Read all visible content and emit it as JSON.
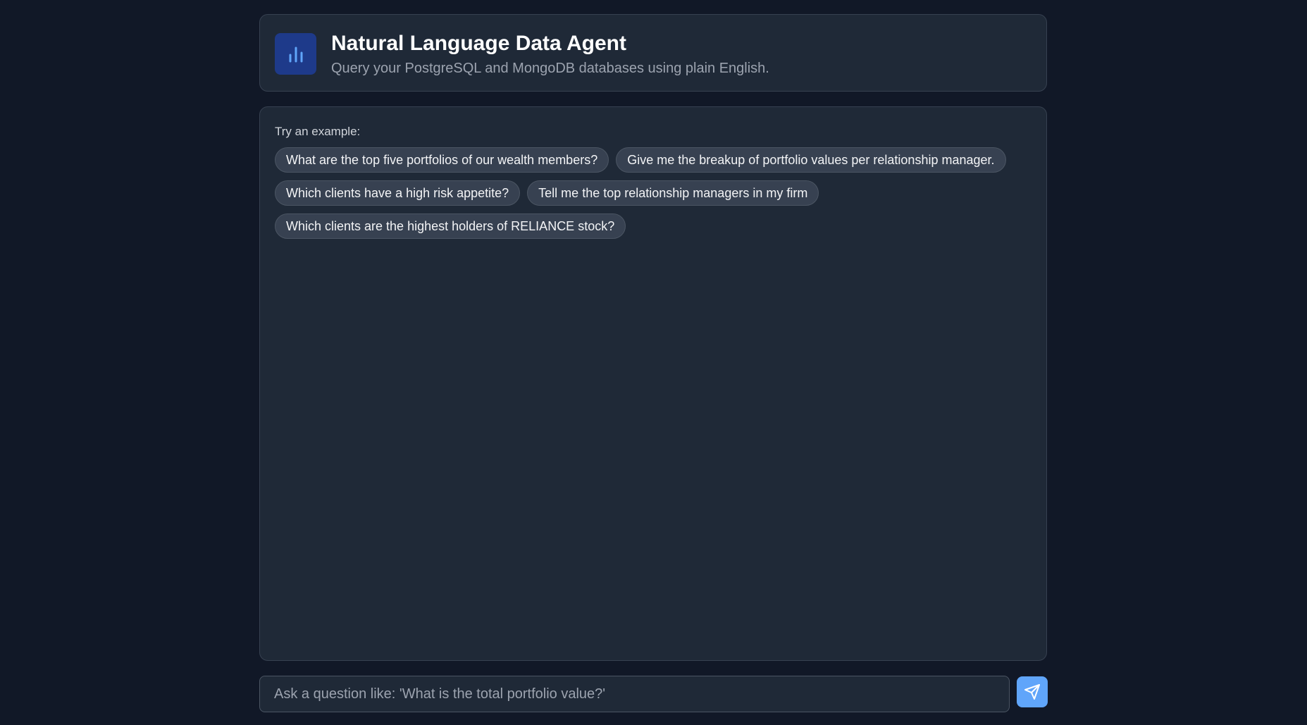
{
  "header": {
    "logo_icon": "bar-chart-icon",
    "title": "Natural Language Data Agent",
    "subtitle": "Query your PostgreSQL and MongoDB databases using plain English."
  },
  "examples": {
    "label": "Try an example:",
    "items": [
      "What are the top five portfolios of our wealth members?",
      "Give me the breakup of portfolio values per relationship manager.",
      "Which clients have a high risk appetite?",
      "Tell me the top relationship managers in my firm",
      "Which clients are the highest holders of RELIANCE stock?"
    ]
  },
  "input": {
    "placeholder": "Ask a question like: 'What is the total portfolio value?'",
    "value": ""
  },
  "send": {
    "icon": "send-icon"
  },
  "colors": {
    "background": "#111827",
    "panel": "#1f2937",
    "accent": "#60a5fa",
    "logo_bg": "#1e3a8a"
  }
}
